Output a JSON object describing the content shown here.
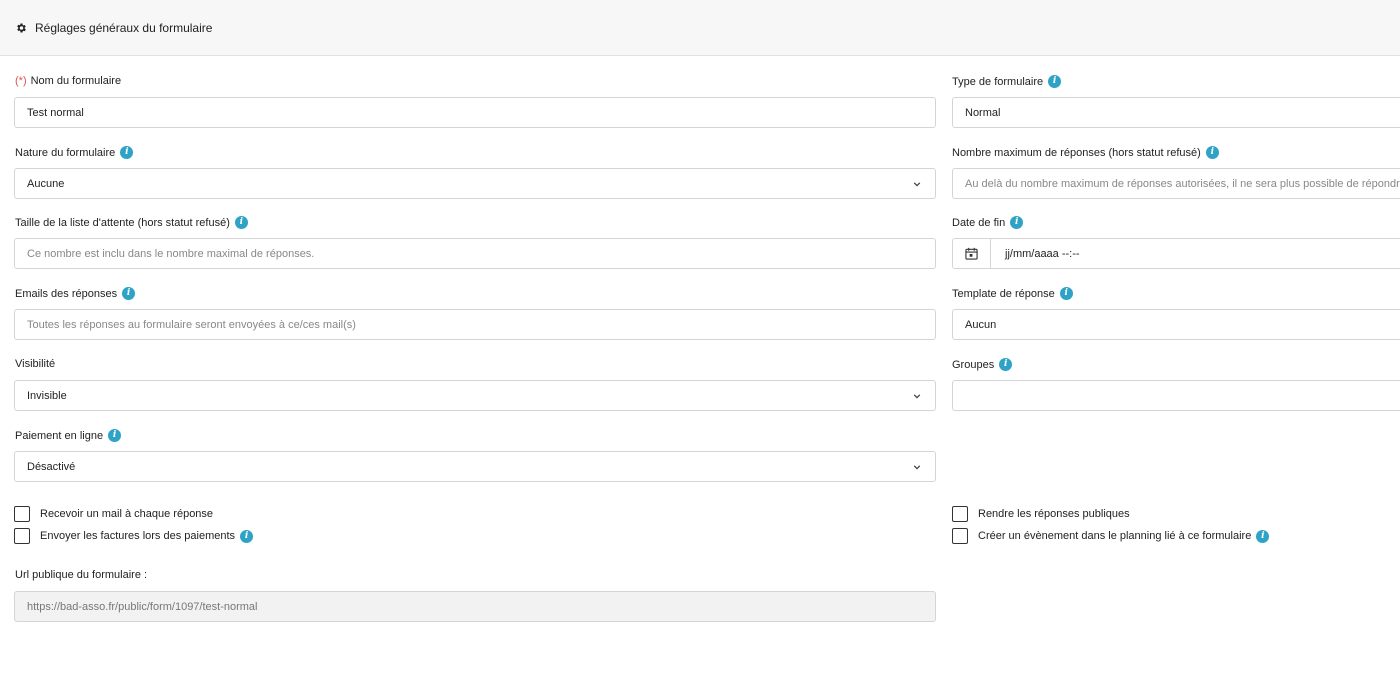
{
  "header": {
    "title": "Réglages généraux du formulaire",
    "icon": "gear-icon"
  },
  "form": {
    "required_marker": "(*)",
    "nom": {
      "label": "Nom du formulaire",
      "value": "Test normal"
    },
    "type": {
      "label": "Type de formulaire",
      "value": "Normal"
    },
    "nature": {
      "label": "Nature du formulaire",
      "value": "Aucune"
    },
    "max_reponses": {
      "label": "Nombre maximum de réponses (hors statut refusé)",
      "placeholder": "Au delà du nombre maximum de réponses autorisées, il ne sera plus possible de répondre"
    },
    "liste_attente": {
      "label": "Taille de la liste d'attente (hors statut refusé)",
      "placeholder": "Ce nombre est inclu dans le nombre maximal de réponses."
    },
    "date_fin": {
      "label": "Date de fin",
      "value": "jj/mm/aaaa --:--"
    },
    "emails": {
      "label": "Emails des réponses",
      "placeholder": "Toutes les réponses au formulaire seront envoyées à ce/ces mail(s)"
    },
    "template": {
      "label": "Template de réponse",
      "value": "Aucun"
    },
    "visibilite": {
      "label": "Visibilité",
      "value": "Invisible"
    },
    "groupes": {
      "label": "Groupes",
      "value": ""
    },
    "paiement": {
      "label": "Paiement en ligne",
      "value": "Désactivé"
    },
    "checkboxes": {
      "recevoir_mail": "Recevoir un mail à chaque réponse",
      "envoyer_factures": "Envoyer les factures lors des paiements",
      "reponses_publiques": "Rendre les réponses publiques",
      "evenement_planning": "Créer un évènement dans le planning lié à ce formulaire"
    },
    "url_publique": {
      "label": "Url publique du formulaire :",
      "value": "https://bad-asso.fr/public/form/1097/test-normal"
    }
  },
  "colors": {
    "info": "#2ea3c6",
    "required": "#d9534f"
  }
}
